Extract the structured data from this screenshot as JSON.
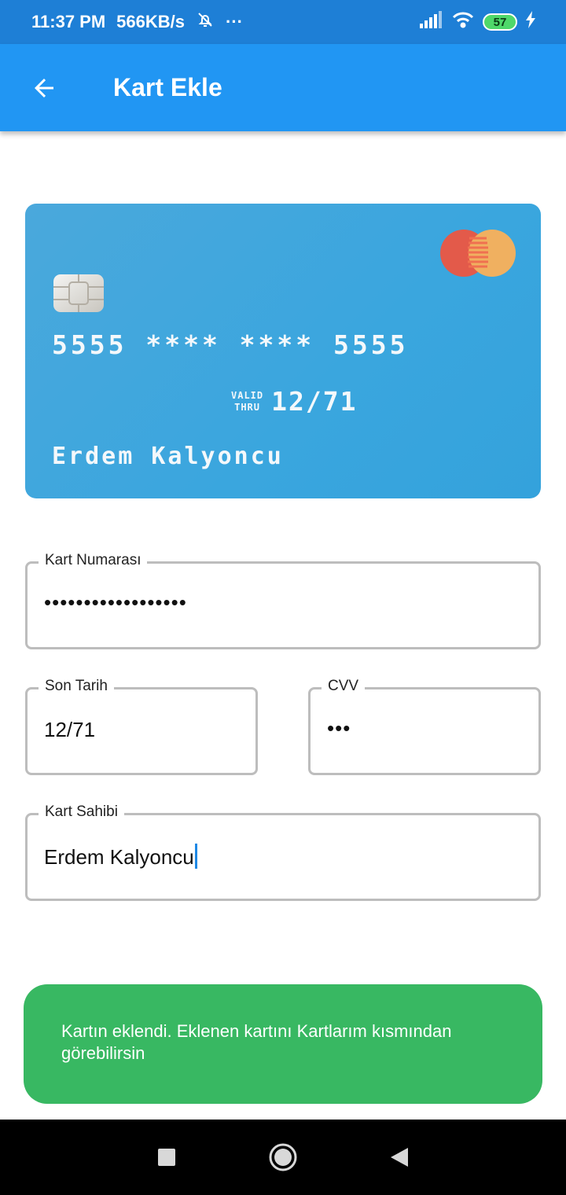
{
  "status_bar": {
    "time": "11:37 PM",
    "speed": "566KB/s",
    "more": "···",
    "battery": "57"
  },
  "app_bar": {
    "title": "Kart Ekle"
  },
  "card": {
    "number": "5555 **** **** 5555",
    "valid_line1": "VALID",
    "valid_line2": "THRU",
    "expiry": "12/71",
    "holder": "Erdem Kalyoncu",
    "colors": {
      "background": "#3aa6de",
      "mc_red": "#e35a4a",
      "mc_orange": "#f0b060"
    }
  },
  "form": {
    "card_number": {
      "label": "Kart Numarası",
      "value": "••••••••••••••••••"
    },
    "expiry": {
      "label": "Son Tarih",
      "value": "12/71"
    },
    "cvv": {
      "label": "CVV",
      "value": "•••"
    },
    "holder": {
      "label": "Kart Sahibi",
      "value": "Erdem Kalyoncu"
    }
  },
  "snackbar": {
    "message": "Kartın eklendi. Eklenen kartını Kartlarım kısmından görebilirsin",
    "color": "#38b862"
  },
  "nav": {
    "icons": [
      "recent-apps-icon",
      "home-icon",
      "back-icon"
    ]
  },
  "theme": {
    "primary": "#2196f3",
    "status_bar": "#1e7fd6"
  }
}
